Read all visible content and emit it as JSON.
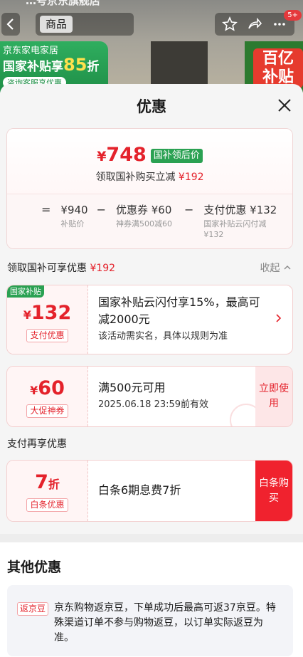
{
  "backdrop": {
    "store_title": "…号京东旗舰店",
    "nav_tab": "商品",
    "message_badge": "5+",
    "promo_line1": "京东家电家居",
    "promo_line2_prefix": "国家补贴享",
    "promo_line2_big": "85",
    "promo_line2_suffix": "折",
    "promo_line3": "咨询客服享优惠",
    "badge_line1": "百亿",
    "badge_line2": "补贴",
    "icons": [
      "back-arrow-icon",
      "star-icon",
      "share-icon",
      "more-icon"
    ]
  },
  "sheet": {
    "title": "优惠",
    "summary": {
      "currency": "¥",
      "final_price": "748",
      "price_tag": "国补领后价",
      "subtitle_prefix": "领取国补购买立减",
      "subtitle_amount": "¥192",
      "calc": {
        "equals": "=",
        "minus": "−",
        "items": [
          {
            "main": "¥940",
            "sub": "补贴价"
          },
          {
            "main": "优惠券 ¥60",
            "sub": "神券满500减60"
          },
          {
            "main": "支付优惠 ¥132",
            "sub": "国家补贴云闪付减¥132"
          }
        ]
      }
    },
    "gov_section": {
      "label": "领取国补可享优惠",
      "amount": "¥192",
      "collapse_label": "收起"
    },
    "coupons": [
      {
        "badge": "国家补贴",
        "currency": "¥",
        "amount": "132",
        "tag": "支付优惠",
        "title": "国家补贴云闪付享15%，最高可减2000元",
        "desc": "该活动需实名，具体以规则为准"
      },
      {
        "currency": "¥",
        "amount": "60",
        "tag": "大促神券",
        "title": "满500元可用",
        "desc": "2025.06.18 23:59前有效",
        "action": "立即使用"
      }
    ],
    "pay_section": {
      "label": "支付再享优惠"
    },
    "pay_coupon": {
      "amount": "7",
      "unit": "折",
      "tag": "白条优惠",
      "title": "白条6期息费7折",
      "action": "白条购买"
    },
    "other": {
      "title": "其他优惠",
      "bean_tag": "返京豆",
      "bean_text": "京东购物返京豆，下单成功后最高可返37京豆。特殊渠道订单不参与购物返豆，以订单实际返豆为准。"
    }
  },
  "colors": {
    "accent_red": "#e4222b",
    "gov_green": "#2aa152",
    "pay_red": "#f0222e"
  }
}
